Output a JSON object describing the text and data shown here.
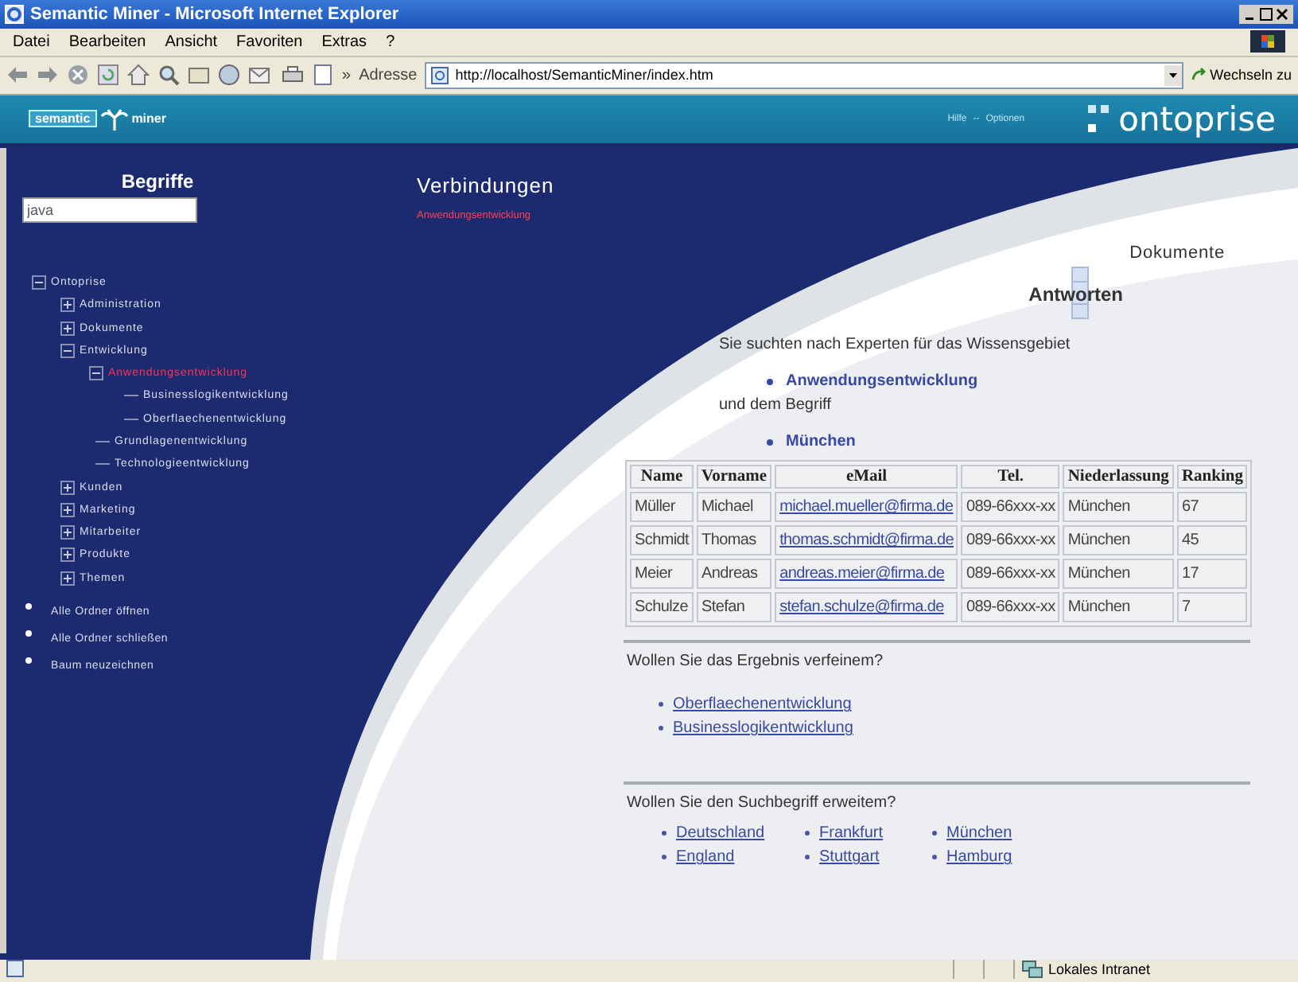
{
  "window": {
    "title": "Semantic Miner - Microsoft Internet Explorer"
  },
  "menu": [
    "Datei",
    "Bearbeiten",
    "Ansicht",
    "Favoriten",
    "Extras",
    "?"
  ],
  "toolbar": {
    "more": "»",
    "address_label": "Adresse",
    "address": "http://localhost/SemanticMiner/index.htm",
    "go": "Wechseln zu"
  },
  "header": {
    "logo_left": "semantic",
    "logo_right": "miner",
    "links": [
      "Hilfe",
      "--",
      "Optionen"
    ],
    "brand": "ontoprise"
  },
  "sidebar": {
    "title": "Begriffe",
    "search": {
      "value": "java"
    },
    "tree": [
      {
        "label": "Ontoprise",
        "expanded": true,
        "selected": false,
        "children": [
          {
            "label": "Administration",
            "expanded": false,
            "selected": false
          },
          {
            "label": "Dokumente",
            "expanded": false,
            "selected": false
          },
          {
            "label": "Entwicklung",
            "expanded": true,
            "selected": false,
            "children": [
              {
                "label": "Anwendungsentwicklung",
                "expanded": true,
                "selected": true,
                "children": [
                  {
                    "label": "Businesslogikentwicklung",
                    "selected": false
                  },
                  {
                    "label": "Oberflaechenentwicklung",
                    "selected": false
                  }
                ]
              },
              {
                "label": "Grundlagenentwicklung",
                "selected": false
              },
              {
                "label": "Technologieentwicklung",
                "selected": false
              }
            ]
          },
          {
            "label": "Kunden",
            "expanded": false,
            "selected": false
          },
          {
            "label": "Marketing",
            "expanded": false,
            "selected": false
          },
          {
            "label": "Mitarbeiter",
            "expanded": false,
            "selected": false
          },
          {
            "label": "Produkte",
            "expanded": false,
            "selected": false
          },
          {
            "label": "Themen",
            "expanded": false,
            "selected": false
          }
        ]
      }
    ],
    "actions": [
      "Alle Ordner öffnen",
      "Alle Ordner schließen",
      "Baum neuzeichnen"
    ]
  },
  "connections": {
    "title": "Verbindungen",
    "items": [
      "Anwendungsentwicklung"
    ]
  },
  "documents_title": "Dokumente",
  "answers": {
    "title": "Antworten",
    "query": [
      {
        "kind": "text",
        "text": "Sie suchten nach Experten für das Wissensgebiet"
      },
      {
        "kind": "term",
        "text": "Anwendungsentwicklung"
      },
      {
        "kind": "text",
        "text": "und dem Begriff"
      },
      {
        "kind": "term",
        "text": "München"
      }
    ],
    "table": {
      "columns": [
        "Name",
        "Vorname",
        "eMail",
        "Tel.",
        "Niederlassung",
        "Ranking"
      ],
      "rows": [
        [
          "Müller",
          "Michael",
          "michael.mueller@firma.de",
          "089-66xxx-xx",
          "München",
          "67"
        ],
        [
          "Schmidt",
          "Thomas",
          "thomas.schmidt@firma.de",
          "089-66xxx-xx",
          "München",
          "45"
        ],
        [
          "Meier",
          "Andreas",
          "andreas.meier@firma.de",
          "089-66xxx-xx",
          "München",
          "17"
        ],
        [
          "Schulze",
          "Stefan",
          "stefan.schulze@firma.de",
          "089-66xxx-xx",
          "München",
          "7"
        ]
      ]
    },
    "refine": {
      "question": "Wollen Sie das Ergebnis verfeinem?",
      "links": [
        "Oberflaechenentwicklung",
        "Businesslogikentwicklung"
      ]
    },
    "expand": {
      "question": "Wollen Sie den Suchbegriff erweitem?",
      "links": [
        "Deutschland",
        "Frankfurt",
        "München",
        "England",
        "Stuttgart",
        "Hamburg"
      ]
    }
  },
  "status_bar": {
    "zone": "Lokales Intranet"
  }
}
